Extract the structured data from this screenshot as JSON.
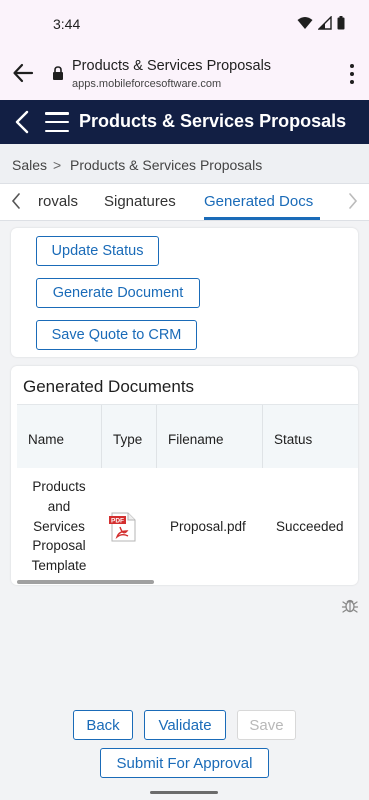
{
  "status_bar": {
    "time": "3:44"
  },
  "browser": {
    "page_title": "Products & Services Proposals",
    "domain": "apps.mobileforcesoftware.com"
  },
  "app_header": {
    "title": "Products & Services Proposals"
  },
  "breadcrumb": {
    "root": "Sales",
    "separator": ">",
    "current": "Products & Services Proposals"
  },
  "tabs": {
    "items": [
      {
        "label": "rovals"
      },
      {
        "label": "Signatures"
      },
      {
        "label": "Generated Docs"
      }
    ],
    "active": "Generated Docs"
  },
  "actions": {
    "update_status": "Update Status",
    "generate_document": "Generate Document",
    "save_quote": "Save Quote to CRM"
  },
  "generated_docs": {
    "title": "Generated Documents",
    "columns": [
      "Name",
      "Type",
      "Filename",
      "Status"
    ],
    "rows": [
      {
        "name_lines": [
          "Products",
          "and",
          "Services",
          "Proposal",
          "Template"
        ],
        "type_icon": "pdf-file-icon",
        "filename": "Proposal.pdf",
        "status": "Succeeded"
      }
    ]
  },
  "footer": {
    "back": "Back",
    "validate": "Validate",
    "save": "Save",
    "submit": "Submit For Approval"
  },
  "colors": {
    "header_bg": "#121f44",
    "accent": "#1a6bb8",
    "browser_bg": "#fbf3fb",
    "page_bg": "#f2f3f5",
    "pdf_red": "#d32f2f"
  }
}
